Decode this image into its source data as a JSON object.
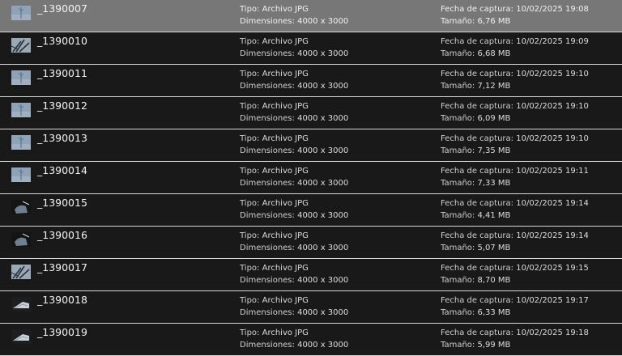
{
  "labels": {
    "type": "Tipo:",
    "dimensions": "Dimensiones:",
    "capture_date": "Fecha de captura:",
    "size": "Tamaño:"
  },
  "colors": {
    "background": "#191919",
    "selected_row": "#777777",
    "row_divider": "#d9d9d9",
    "text": "#e6e6e6"
  },
  "files": [
    {
      "name": "_1390007",
      "type": "Archivo JPG",
      "dimensions": "4000 x 3000",
      "capture_date": "10/02/2025 19:08",
      "size": "6,76 MB",
      "selected": true,
      "thumbnail_icon": "photo-thumbnail-sky"
    },
    {
      "name": "_1390010",
      "type": "Archivo JPG",
      "dimensions": "4000 x 3000",
      "capture_date": "10/02/2025 19:09",
      "size": "6,68 MB",
      "selected": false,
      "thumbnail_icon": "photo-thumbnail-branches"
    },
    {
      "name": "_1390011",
      "type": "Archivo JPG",
      "dimensions": "4000 x 3000",
      "capture_date": "10/02/2025 19:10",
      "size": "7,12 MB",
      "selected": false,
      "thumbnail_icon": "photo-thumbnail-sky"
    },
    {
      "name": "_1390012",
      "type": "Archivo JPG",
      "dimensions": "4000 x 3000",
      "capture_date": "10/02/2025 19:10",
      "size": "6,09 MB",
      "selected": false,
      "thumbnail_icon": "photo-thumbnail-sky"
    },
    {
      "name": "_1390013",
      "type": "Archivo JPG",
      "dimensions": "4000 x 3000",
      "capture_date": "10/02/2025 19:10",
      "size": "7,35 MB",
      "selected": false,
      "thumbnail_icon": "photo-thumbnail-sky"
    },
    {
      "name": "_1390014",
      "type": "Archivo JPG",
      "dimensions": "4000 x 3000",
      "capture_date": "10/02/2025 19:11",
      "size": "7,33 MB",
      "selected": false,
      "thumbnail_icon": "photo-thumbnail-sky"
    },
    {
      "name": "_1390015",
      "type": "Archivo JPG",
      "dimensions": "4000 x 3000",
      "capture_date": "10/02/2025 19:14",
      "size": "4,41 MB",
      "selected": false,
      "thumbnail_icon": "photo-thumbnail-dark"
    },
    {
      "name": "_1390016",
      "type": "Archivo JPG",
      "dimensions": "4000 x 3000",
      "capture_date": "10/02/2025 19:14",
      "size": "5,07 MB",
      "selected": false,
      "thumbnail_icon": "photo-thumbnail-dark"
    },
    {
      "name": "_1390017",
      "type": "Archivo JPG",
      "dimensions": "4000 x 3000",
      "capture_date": "10/02/2025 19:15",
      "size": "8,70 MB",
      "selected": false,
      "thumbnail_icon": "photo-thumbnail-branches"
    },
    {
      "name": "_1390018",
      "type": "Archivo JPG",
      "dimensions": "4000 x 3000",
      "capture_date": "10/02/2025 19:17",
      "size": "6,33 MB",
      "selected": false,
      "thumbnail_icon": "photo-thumbnail-roof"
    },
    {
      "name": "_1390019",
      "type": "Archivo JPG",
      "dimensions": "4000 x 3000",
      "capture_date": "10/02/2025 19:18",
      "size": "5,99 MB",
      "selected": false,
      "thumbnail_icon": "photo-thumbnail-roof"
    }
  ]
}
